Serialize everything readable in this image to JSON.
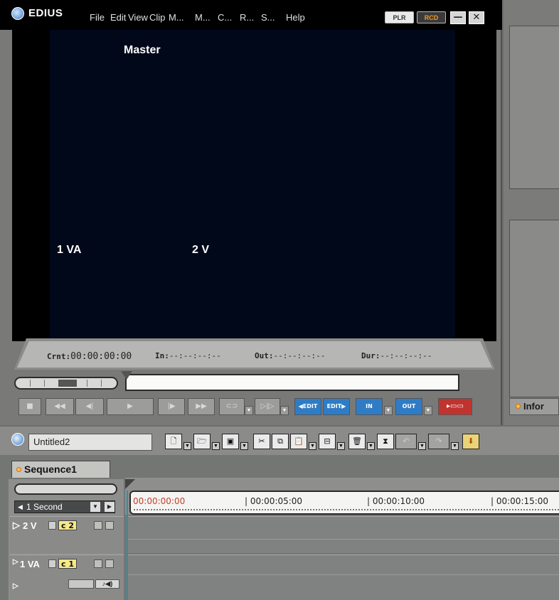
{
  "app": {
    "name": "EDIUS"
  },
  "menu": [
    "File",
    "Edit",
    "View",
    "Clip",
    "M...",
    "M...",
    "C...",
    "R...",
    "S...",
    "Help"
  ],
  "titlebar": {
    "plr": "PLR",
    "rcd": "RCD",
    "minimize": "—",
    "close": "✕"
  },
  "preview": {
    "master_label": "Master",
    "track_label_1": "1 VA",
    "track_label_2": "2 V"
  },
  "timecode": {
    "crnt_label": "Crnt:",
    "crnt_value": "00:00:00:00",
    "in_label": "In:",
    "in_value": "--:--:--:--",
    "out_label": "Out:",
    "out_value": "--:--:--:--",
    "dur_label": "Dur:",
    "dur_value": "--:--:--:--"
  },
  "controls": {
    "stop": "■",
    "rewind": "◀◀",
    "step_back": "◀|",
    "play": "▶",
    "step_fwd": "|▶",
    "ffwd": "▶▶",
    "loop": "⊂⊃",
    "play_around": "▷|▷",
    "edit_back": "◀EDIT",
    "edit_fwd": "EDIT▶",
    "in": "IN",
    "out": "OUT",
    "insert": "▸▭▭"
  },
  "right_panel": {
    "info_tab": "Infor"
  },
  "timeline": {
    "project_name": "Untitled2",
    "sequence_tab": "Sequence1",
    "zoom_label": "1 Second",
    "ruler": {
      "current": "00:00:00:00",
      "mark1": "| 00:00:05:00",
      "mark2": "| 00:00:10:00",
      "mark3": "| 00:00:15:00"
    },
    "tracks": [
      {
        "name": "2 V",
        "channel": "c 2"
      },
      {
        "name": "1 VA",
        "channel": "c 1"
      }
    ]
  },
  "colors": {
    "accent_blue": "#2f7cc6",
    "accent_red": "#c0342f",
    "timecode_current": "#c2402a",
    "channel_highlight": "#f5e98a"
  }
}
